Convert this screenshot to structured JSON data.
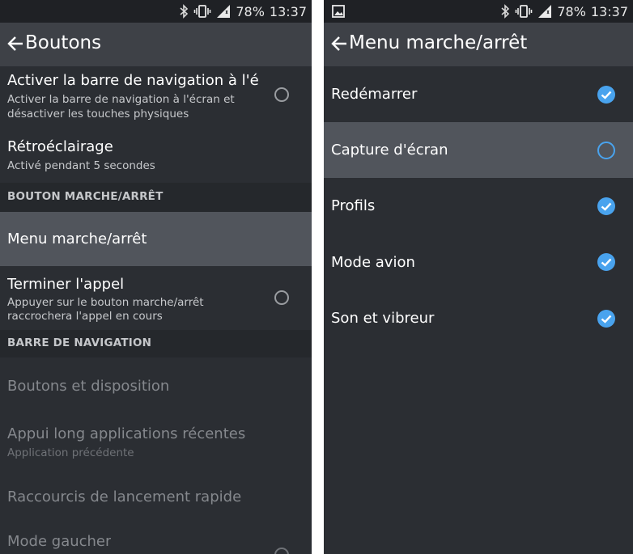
{
  "status": {
    "battery": "78%",
    "time": "13:37"
  },
  "left": {
    "title": "Boutons",
    "items": [
      {
        "title": "Activer la barre de navigation à l'éc..",
        "subtitle_line1": "Activer la barre de navigation à l'écran et",
        "subtitle_line2": "désactiver les touches physiques"
      },
      {
        "title": "Rétroéclairage",
        "subtitle": "Activé pendant 5 secondes"
      },
      {
        "title": "Menu marche/arrêt"
      },
      {
        "title": "Terminer l'appel",
        "subtitle_line1": "Appuyer sur le bouton marche/arrêt",
        "subtitle_line2": "raccrochera l'appel en cours"
      },
      {
        "title": "Boutons et disposition"
      },
      {
        "title": "Appui long applications récentes",
        "subtitle": "Application précédente"
      },
      {
        "title": "Raccourcis de lancement rapide"
      },
      {
        "title": "Mode gaucher"
      }
    ],
    "sections": [
      "BOUTON MARCHE/ARRÊT",
      "BARRE DE NAVIGATION"
    ]
  },
  "right": {
    "title": "Menu marche/arrêt",
    "items": [
      {
        "label": "Redémarrer",
        "checked": true
      },
      {
        "label": "Capture d'écran",
        "checked": false
      },
      {
        "label": "Profils",
        "checked": true
      },
      {
        "label": "Mode avion",
        "checked": true
      },
      {
        "label": "Son et vibreur",
        "checked": true
      }
    ]
  },
  "colors": {
    "accent": "#49a3ee",
    "background": "#2b2e33",
    "appbar": "#3e4147"
  }
}
